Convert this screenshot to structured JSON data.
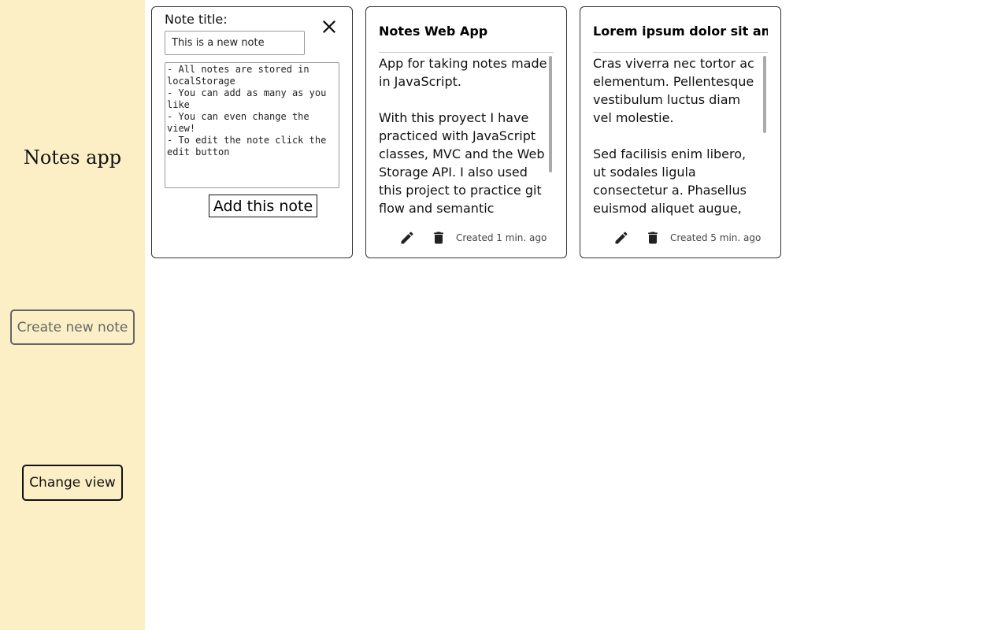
{
  "sidebar": {
    "title": "Notes app",
    "create_label": "Create new note",
    "view_label": "Change view"
  },
  "new_note": {
    "label": "Note title:",
    "title_value": "This is a new note",
    "body_value": "- All notes are stored in localStorage\n- You can add as many as you like\n- You can even change the view!\n- To edit the note click the edit button",
    "add_label": "Add this note",
    "close_icon": "close-icon"
  },
  "notes": [
    {
      "title": "Notes Web App",
      "body": "App for taking notes made in JavaScript.\n\nWith this proyect I have practiced with JavaScript classes, MVC and the Web Storage API. I also used this project to practice git flow and semantic versioning (I",
      "created": "Created 1 min. ago"
    },
    {
      "title": "Lorem ipsum dolor sit amet",
      "body": "Cras viverra nec tortor ac elementum. Pellentesque vestibulum luctus diam vel molestie.\n\nSed facilisis enim libero, ut sodales ligula consectetur a. Phasellus euismod aliquet augue, eget lacinia neque",
      "created": "Created 5 min. ago"
    }
  ],
  "colors": {
    "sidebar_bg": "#fcefc5",
    "border": "#333333"
  }
}
